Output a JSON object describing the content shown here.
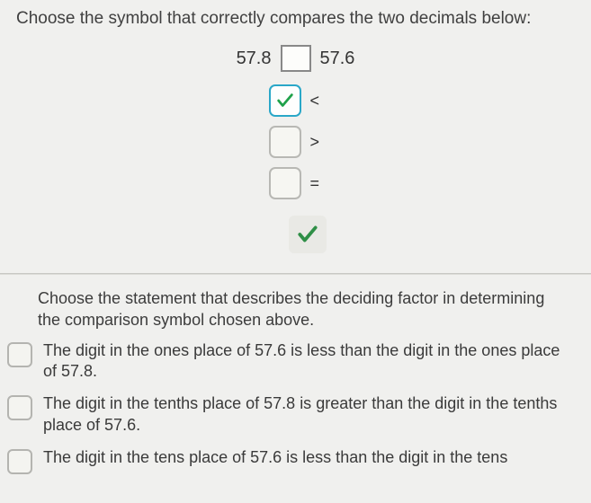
{
  "part1": {
    "prompt": "Choose the symbol that correctly compares the two decimals below:",
    "left_value": "57.8",
    "right_value": "57.6",
    "options": [
      {
        "symbol": "<",
        "selected": true
      },
      {
        "symbol": ">",
        "selected": false
      },
      {
        "symbol": "=",
        "selected": false
      }
    ]
  },
  "part2": {
    "prompt": "Choose the statement that describes the deciding factor in determining the comparison symbol chosen above.",
    "choices": [
      "The digit in the ones place of 57.6 is less than the digit in the ones place of 57.8.",
      "The digit in the tenths place of 57.8 is greater than the digit in the tenths place of 57.6.",
      "The digit in the tens place of 57.6 is less than the digit in the tens"
    ]
  }
}
